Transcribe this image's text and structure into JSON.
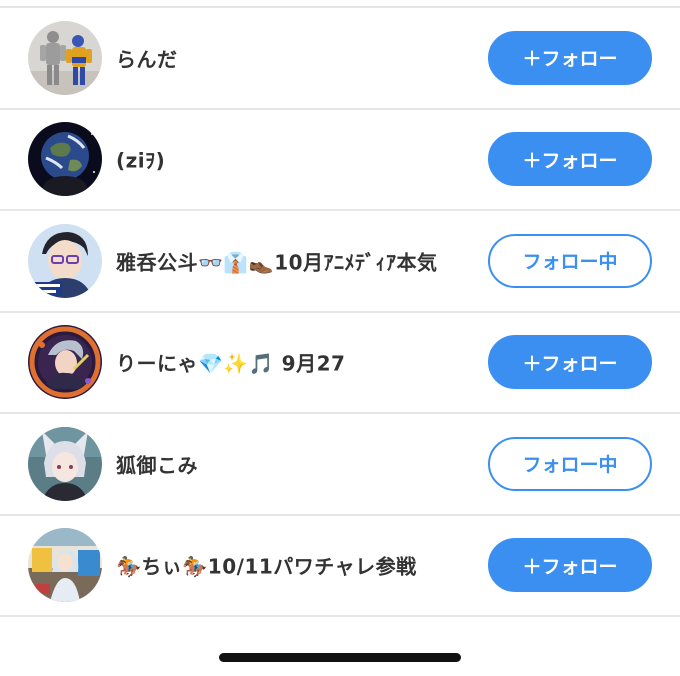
{
  "users": [
    {
      "name": "らんだ",
      "button_label": "＋フォロー",
      "following": false,
      "avatar_icon": "action-figures-avatar"
    },
    {
      "name": "(ziｦ)",
      "button_label": "＋フォロー",
      "following": false,
      "avatar_icon": "earth-avatar"
    },
    {
      "name": "雅呑公斗👓👔👞10月ｱﾆﾒﾃﾞｨｱ本気",
      "button_label": "フォロー中",
      "following": true,
      "avatar_icon": "anime-glasses-avatar"
    },
    {
      "name": "りーにゃ💎✨🎵 9月27",
      "button_label": "＋フォロー",
      "following": false,
      "avatar_icon": "anime-character-avatar"
    },
    {
      "name": "狐御こみ",
      "button_label": "フォロー中",
      "following": true,
      "avatar_icon": "fox-ears-avatar"
    },
    {
      "name": "🏇ちぃ🏇10/11パワチャレ参戦",
      "button_label": "＋フォロー",
      "following": false,
      "avatar_icon": "racing-game-avatar"
    }
  ],
  "colors": {
    "accent": "#3b8ff0",
    "divider": "#e6e6ea",
    "text": "#333333"
  }
}
